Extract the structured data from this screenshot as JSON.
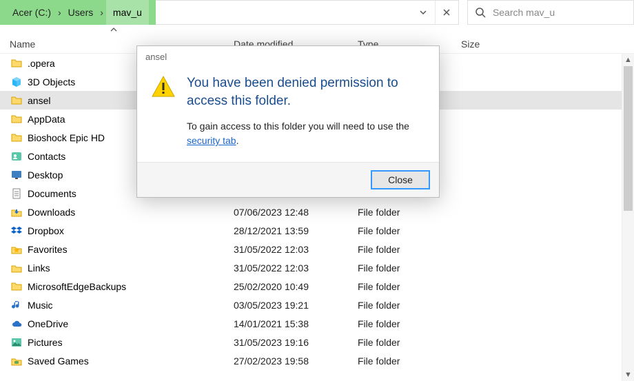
{
  "breadcrumb": {
    "parts": [
      "Acer (C:)",
      "Users",
      "mav_u"
    ]
  },
  "search": {
    "placeholder": "Search mav_u"
  },
  "headers": {
    "name": "Name",
    "date": "Date modified",
    "type": "Type",
    "size": "Size"
  },
  "rows": [
    {
      "name": ".opera",
      "date": "",
      "type": "",
      "icon": "folder"
    },
    {
      "name": "3D Objects",
      "date": "",
      "type": "",
      "icon": "objects3d"
    },
    {
      "name": "ansel",
      "date": "",
      "type": "",
      "icon": "folder",
      "selected": true
    },
    {
      "name": "AppData",
      "date": "",
      "type": "",
      "icon": "folder"
    },
    {
      "name": "Bioshock Epic HD",
      "date": "",
      "type": "",
      "icon": "folder"
    },
    {
      "name": "Contacts",
      "date": "",
      "type": "",
      "icon": "contacts"
    },
    {
      "name": "Desktop",
      "date": "",
      "type": "",
      "icon": "desktop"
    },
    {
      "name": "Documents",
      "date": "",
      "type": "",
      "icon": "documents"
    },
    {
      "name": "Downloads",
      "date": "07/06/2023 12:48",
      "type": "File folder",
      "icon": "downloads"
    },
    {
      "name": "Dropbox",
      "date": "28/12/2021 13:59",
      "type": "File folder",
      "icon": "dropbox"
    },
    {
      "name": "Favorites",
      "date": "31/05/2022 12:03",
      "type": "File folder",
      "icon": "favorites"
    },
    {
      "name": "Links",
      "date": "31/05/2022 12:03",
      "type": "File folder",
      "icon": "links"
    },
    {
      "name": "MicrosoftEdgeBackups",
      "date": "25/02/2020 10:49",
      "type": "File folder",
      "icon": "folder"
    },
    {
      "name": "Music",
      "date": "03/05/2023 19:21",
      "type": "File folder",
      "icon": "music"
    },
    {
      "name": "OneDrive",
      "date": "14/01/2021 15:38",
      "type": "File folder",
      "icon": "onedrive"
    },
    {
      "name": "Pictures",
      "date": "31/05/2023 19:16",
      "type": "File folder",
      "icon": "pictures"
    },
    {
      "name": "Saved Games",
      "date": "27/02/2023 19:58",
      "type": "File folder",
      "icon": "savedgames"
    }
  ],
  "dialog": {
    "title": "ansel",
    "heading": "You have been denied permission to access this folder.",
    "body_pre": "To gain access to this folder you will need to use the ",
    "link": "security tab",
    "body_post": ".",
    "close": "Close"
  }
}
